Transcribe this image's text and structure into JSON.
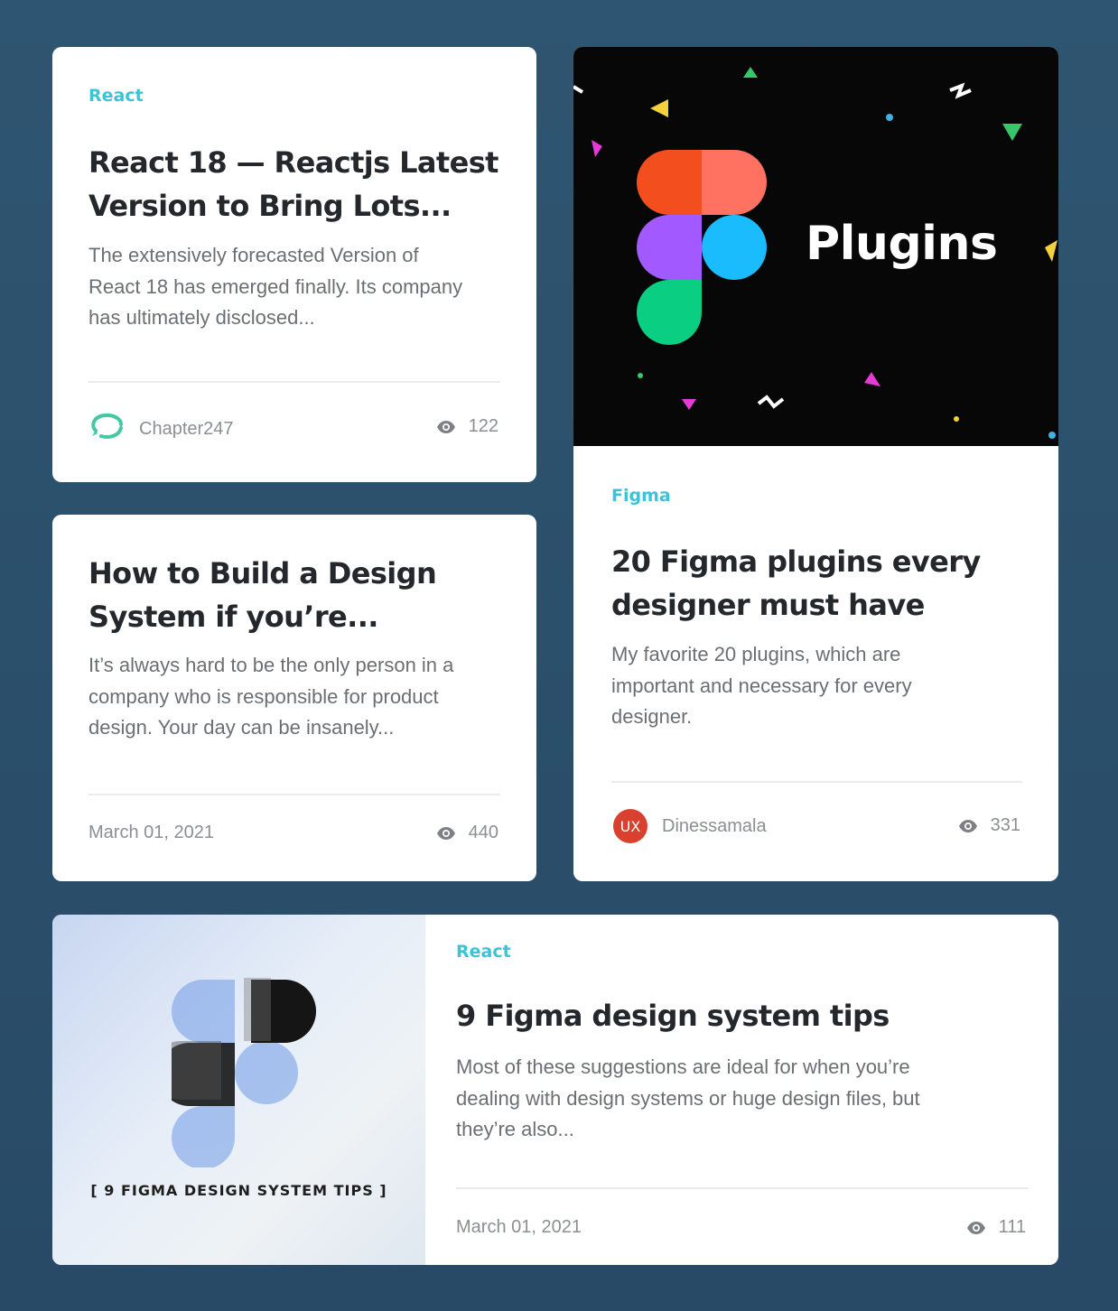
{
  "cards": [
    {
      "tag": "React",
      "title_line1": "React 18 — Reactjs Latest",
      "title_line2": "Version to Bring Lots...",
      "excerpt": [
        "The extensively forecasted Version of",
        "React 18 has emerged finally. Its company",
        "has ultimately disclosed..."
      ],
      "author": "Chapter247",
      "views": "122"
    },
    {
      "title_line1": "How to Build a Design",
      "title_line2": "System if you’re...",
      "excerpt": [
        "It’s always hard to be the only person in a",
        "company who is responsible for product",
        "design. Your day can be insanely..."
      ],
      "date": "March 01, 2021",
      "views": "440"
    },
    {
      "image_text": "Plugins",
      "tag": "Figma",
      "title_line1": "20 Figma plugins every",
      "title_line2": "designer must have",
      "excerpt": [
        "My favorite 20 plugins, which are",
        "important and necessary for every",
        "designer."
      ],
      "author_avatar": "UX",
      "author": "Dinessamala",
      "views": "331"
    },
    {
      "image_caption": "[ 9 FIGMA DESIGN SYSTEM TIPS ]",
      "tag": "React",
      "title": "9 Figma design system tips",
      "excerpt": [
        "Most of these suggestions are ideal for when you’re",
        "dealing with design systems or huge design files, but",
        "they’re also..."
      ],
      "date": "March 01, 2021",
      "views": "111"
    }
  ],
  "colors": {
    "background": "#2b4f6b",
    "tag": "#3cc3d8",
    "title": "#24282c",
    "muted": "#8b8f93",
    "ux_avatar": "#d9412e"
  }
}
